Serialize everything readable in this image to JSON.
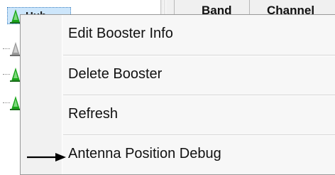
{
  "background": {
    "tree_items": [
      {
        "label": "Hub",
        "selected": true,
        "icon": "tower-icon"
      },
      {
        "label": "",
        "selected": false,
        "icon": "tower-icon"
      },
      {
        "label": "",
        "selected": false,
        "icon": "tower-icon"
      },
      {
        "label": "",
        "selected": false,
        "icon": "tower-icon"
      }
    ],
    "grid_columns": [
      "",
      "Band",
      "Channel"
    ]
  },
  "context_menu": {
    "items": [
      {
        "label": "Edit Booster Info"
      },
      {
        "label": "Delete Booster"
      },
      {
        "label": "Refresh"
      },
      {
        "label": "Antenna Position Debug"
      }
    ]
  },
  "annotation": {
    "arrow_target": "Antenna Position Debug",
    "arrow_icon": "arrow-right-icon"
  },
  "colors": {
    "tower_icon": "#1aa51a",
    "selection": "#cde6fb",
    "menu_background": "#f7f7f7"
  }
}
